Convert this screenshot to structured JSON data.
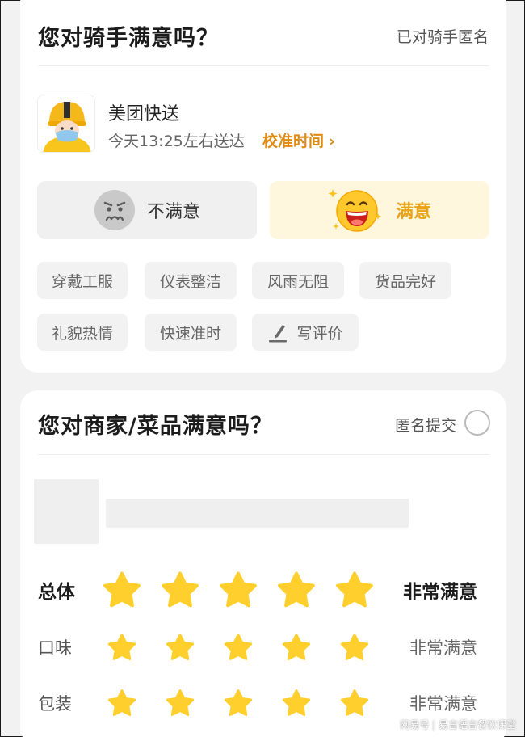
{
  "colors": {
    "accent": "#e08a12",
    "star": "#ffcf2e",
    "satisfied_bg": "#fff6de",
    "satisfied_text": "#e8a317"
  },
  "rider_section": {
    "title": "您对骑手满意吗？",
    "anonymous_label": "已对骑手匿名",
    "rider_name": "美团快送",
    "delivery_time": "今天13:25左右送达",
    "calibrate_link": "校准时间",
    "unsatisfied_label": "不满意",
    "satisfied_label": "满意",
    "selected": "satisfied",
    "tags": [
      "穿戴工服",
      "仪表整洁",
      "风雨无阻",
      "货品完好",
      "礼貌热情",
      "快速准时"
    ],
    "write_review_label": "写评价"
  },
  "merchant_section": {
    "title": "您对商家/菜品满意吗？",
    "anonymous_label": "匿名提交",
    "anonymous_checked": false,
    "ratings": [
      {
        "label": "总体",
        "stars": 5,
        "max": 5,
        "value": "非常满意"
      },
      {
        "label": "口味",
        "stars": 5,
        "max": 5,
        "value": "非常满意"
      },
      {
        "label": "包装",
        "stars": 5,
        "max": 5,
        "value": "非常满意"
      }
    ]
  },
  "watermark": "网易号 | 易言语言餐饮课堂"
}
